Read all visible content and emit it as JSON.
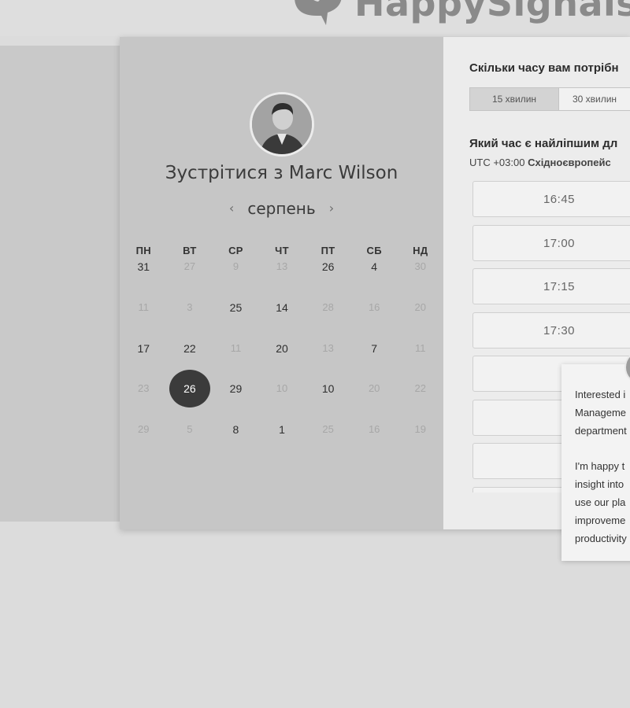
{
  "brand": {
    "name": "HappySignals"
  },
  "scheduler": {
    "title": "Зустрітися з Marc Wilson",
    "month": "серпень",
    "prev_icon": "chevron-left-icon",
    "next_icon": "chevron-right-icon",
    "weekdays": [
      "ПН",
      "ВТ",
      "СР",
      "ЧТ",
      "ПТ",
      "СБ",
      "НД"
    ],
    "weeks": [
      [
        "31",
        "27",
        "9",
        "13",
        "26",
        "4",
        "30"
      ],
      [
        "11",
        "3",
        "25",
        "14",
        "28",
        "16",
        "20"
      ],
      [
        "17",
        "22",
        "11",
        "20",
        "13",
        "7",
        "11"
      ],
      [
        "23",
        "26",
        "29",
        "10",
        "10",
        "20",
        "22"
      ],
      [
        "29",
        "5",
        "8",
        "1",
        "25",
        "16",
        "19"
      ]
    ],
    "selected_day": "26"
  },
  "time_panel": {
    "duration_question": "Скільки часу вам потрібн",
    "durations": [
      "15 хвилин",
      "30 хвилин"
    ],
    "selected_duration": "15 хвилин",
    "time_question": "Який час є найліпшим дл",
    "timezone_prefix": "UTC +03:00",
    "timezone_name": "Східноєвропейс",
    "slots": [
      "16:45",
      "17:00",
      "17:15",
      "17:30",
      "",
      "",
      "",
      ""
    ]
  },
  "chat_popup": {
    "paragraph1": [
      "Interested i",
      "Manageme",
      "department"
    ],
    "paragraph2": [
      "I'm happy t",
      "insight into",
      "use our pla",
      "improveme",
      "productivity"
    ]
  },
  "colors": {
    "selected_day_bg": "#3b3b3b",
    "calendar_bg": "#c6c6c6",
    "page_bg": "#dcdcdc"
  }
}
